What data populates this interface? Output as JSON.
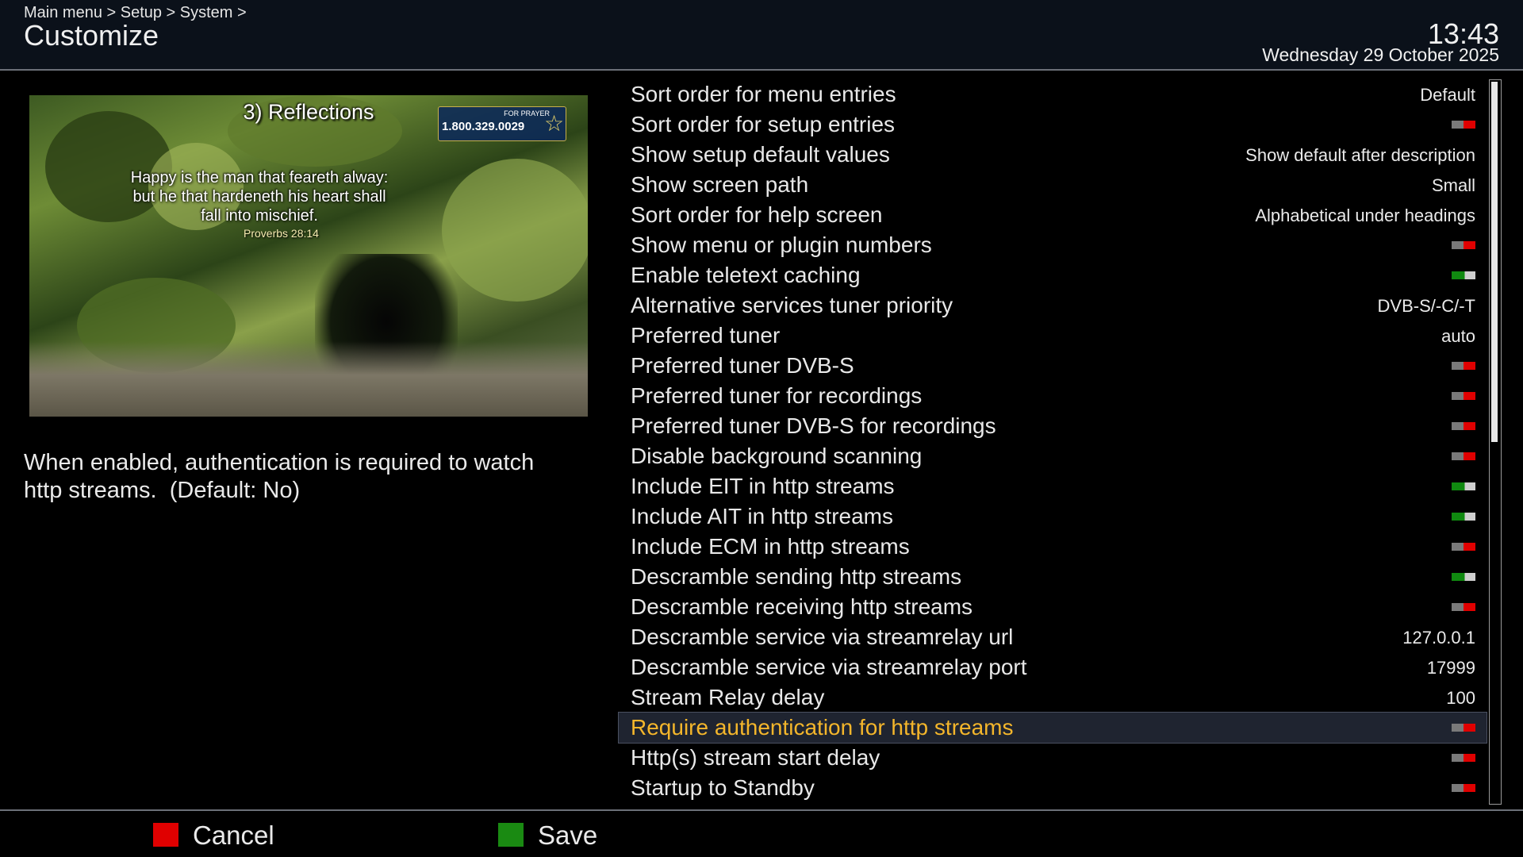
{
  "header": {
    "breadcrumb": "Main menu > Setup > System >",
    "title": "Customize",
    "time": "13:43",
    "date": "Wednesday 29 October 2025"
  },
  "preview": {
    "caption": "3) Reflections",
    "prayer_label": "FOR PRAYER",
    "prayer_number": "1.800.329.0029",
    "verse": "Happy is the man that feareth alway:\nbut he that hardeneth his heart shall\nfall into mischief.",
    "verse_ref": "Proverbs 28:14"
  },
  "description": "When enabled, authentication is required to watch\nhttp streams.  (Default: No)",
  "settings": [
    {
      "label": "Sort order for menu entries",
      "value": "Default"
    },
    {
      "label": "Sort order for setup entries",
      "toggle": "off"
    },
    {
      "label": "Show setup default values",
      "value": "Show default after description"
    },
    {
      "label": "Show screen path",
      "value": "Small"
    },
    {
      "label": "Sort order for help screen",
      "value": "Alphabetical under headings"
    },
    {
      "label": "Show menu or plugin numbers",
      "toggle": "off"
    },
    {
      "label": "Enable teletext caching",
      "toggle": "on"
    },
    {
      "label": "Alternative services tuner priority",
      "value": "DVB-S/-C/-T"
    },
    {
      "label": "Preferred tuner",
      "value": "auto"
    },
    {
      "label": "Preferred tuner DVB-S",
      "toggle": "off"
    },
    {
      "label": "Preferred tuner for recordings",
      "toggle": "off"
    },
    {
      "label": "Preferred tuner DVB-S for recordings",
      "toggle": "off"
    },
    {
      "label": "Disable background scanning",
      "toggle": "off"
    },
    {
      "label": "Include EIT in http streams",
      "toggle": "on"
    },
    {
      "label": "Include AIT in http streams",
      "toggle": "on"
    },
    {
      "label": "Include ECM in http streams",
      "toggle": "off"
    },
    {
      "label": "Descramble sending http streams",
      "toggle": "on"
    },
    {
      "label": "Descramble receiving http streams",
      "toggle": "off"
    },
    {
      "label": "Descramble service via streamrelay url",
      "value": "127.0.0.1"
    },
    {
      "label": "Descramble service via streamrelay port",
      "value": "17999"
    },
    {
      "label": "Stream Relay delay",
      "value": "100"
    },
    {
      "label": "Require authentication for http streams",
      "toggle": "off",
      "selected": true
    },
    {
      "label": "Http(s) stream start delay",
      "toggle": "off"
    },
    {
      "label": "Startup to Standby",
      "toggle": "off"
    }
  ],
  "scroll_fraction_visible": 0.5,
  "footer": {
    "cancel": "Cancel",
    "save": "Save",
    "cancel_color": "#e00000",
    "save_color": "#1a8a12"
  },
  "colors": {
    "selected_text": "#f4b62b",
    "toggle_off": "#e00000",
    "toggle_on": "#108a10"
  }
}
